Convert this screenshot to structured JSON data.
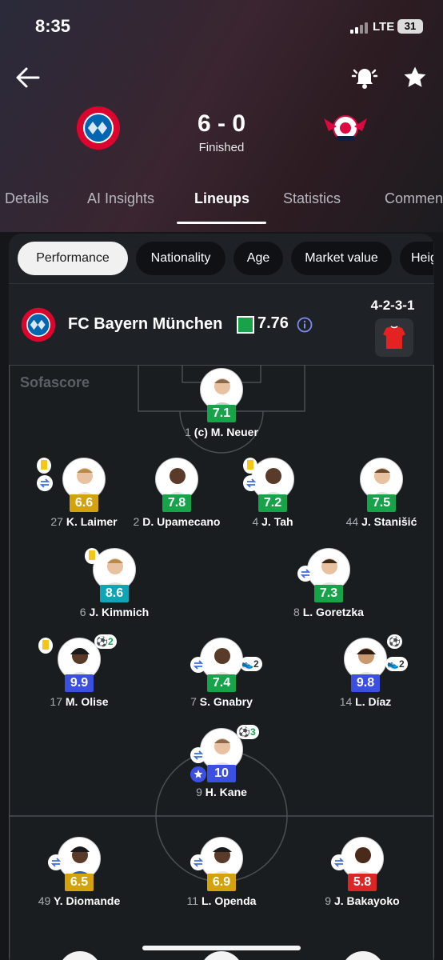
{
  "status_bar": {
    "time": "8:35",
    "network": "LTE",
    "battery": "31"
  },
  "match": {
    "score": "6 - 0",
    "status": "Finished",
    "home_team": "FC Bayern München",
    "home_crest_text": "FC BAYERN MÜNCHEN",
    "away_crest_text": "RB LEIPZIG"
  },
  "tabs": [
    {
      "label": "Details",
      "active": false
    },
    {
      "label": "AI Insights",
      "active": false
    },
    {
      "label": "Lineups",
      "active": true
    },
    {
      "label": "Statistics",
      "active": false
    },
    {
      "label": "Commen",
      "active": false
    }
  ],
  "filter_chips": [
    {
      "label": "Performance",
      "active": true
    },
    {
      "label": "Nationality",
      "active": false
    },
    {
      "label": "Age",
      "active": false
    },
    {
      "label": "Market value",
      "active": false
    },
    {
      "label": "Heigh",
      "active": false
    }
  ],
  "lineup": {
    "team_name": "FC Bayern München",
    "team_rating": "7.76",
    "formation": "4-2-3-1",
    "watermark": "Sofascore"
  },
  "colors": {
    "rating_green": "#16a34a",
    "rating_yellow": "#d4a20c",
    "rating_teal": "#0ea5b7",
    "rating_blue": "#3b4fe0",
    "rating_red": "#dc2626",
    "kit_red": "#e32221"
  },
  "players": [
    {
      "number": "1",
      "name": "(c) M. Neuer",
      "rating": "7.1",
      "rating_color": "green"
    },
    {
      "number": "27",
      "name": "K. Laimer",
      "rating": "6.6",
      "rating_color": "yellow"
    },
    {
      "number": "2",
      "name": "D. Upamecano",
      "rating": "7.8",
      "rating_color": "green"
    },
    {
      "number": "4",
      "name": "J. Tah",
      "rating": "7.2",
      "rating_color": "green"
    },
    {
      "number": "44",
      "name": "J. Stanišić",
      "rating": "7.5",
      "rating_color": "green"
    },
    {
      "number": "6",
      "name": "J. Kimmich",
      "rating": "8.6",
      "rating_color": "teal"
    },
    {
      "number": "8",
      "name": "L. Goretzka",
      "rating": "7.3",
      "rating_color": "green"
    },
    {
      "number": "17",
      "name": "M. Olise",
      "rating": "9.9",
      "rating_color": "blue",
      "goals": "2"
    },
    {
      "number": "7",
      "name": "S. Gnabry",
      "rating": "7.4",
      "rating_color": "green",
      "assists": "2"
    },
    {
      "number": "14",
      "name": "L. Díaz",
      "rating": "9.8",
      "rating_color": "blue",
      "assists": "2"
    },
    {
      "number": "9",
      "name": "H. Kane",
      "rating": "10",
      "rating_color": "blue",
      "goals": "3"
    },
    {
      "number": "49",
      "name": "Y. Diomande",
      "rating": "6.5",
      "rating_color": "yellow"
    },
    {
      "number": "11",
      "name": "L. Openda",
      "rating": "6.9",
      "rating_color": "yellow"
    },
    {
      "number": "9",
      "name": "J. Bakayoko",
      "rating": "5.8",
      "rating_color": "red"
    }
  ],
  "icons": [
    "back-arrow-icon",
    "bell-icon",
    "star-icon",
    "info-icon",
    "yellow-card-icon",
    "substitution-icon",
    "goal-icon",
    "assist-icon",
    "player-of-the-match-icon"
  ]
}
